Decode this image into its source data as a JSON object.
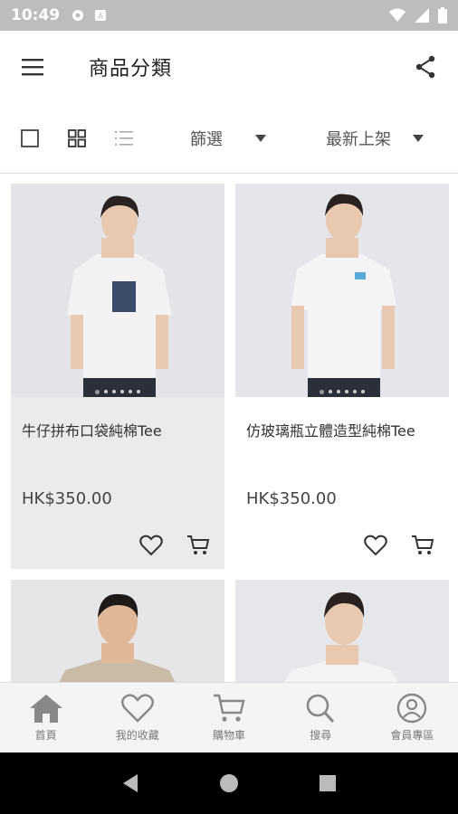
{
  "status_bar": {
    "time": "10:49"
  },
  "app_bar": {
    "title": "商品分類"
  },
  "toolbar": {
    "filter_label": "篩選",
    "sort_label": "最新上架"
  },
  "products": [
    {
      "name": "牛仔拼布口袋純棉Tee",
      "price": "HK$350.00"
    },
    {
      "name": "仿玻璃瓶立體造型純棉Tee",
      "price": "HK$350.00"
    },
    {
      "name": "",
      "price": ""
    },
    {
      "name": "",
      "price": ""
    }
  ],
  "bottom_nav": {
    "items": [
      {
        "label": "首頁",
        "icon": "home-icon"
      },
      {
        "label": "我的收藏",
        "icon": "heart-icon"
      },
      {
        "label": "購物車",
        "icon": "cart-icon"
      },
      {
        "label": "搜尋",
        "icon": "search-icon"
      },
      {
        "label": "會員專區",
        "icon": "user-icon"
      }
    ]
  },
  "colors": {
    "status_bar": "#bdbdbd",
    "card_highlight": "#ebebeb",
    "nav_bg": "#f4f4f4"
  }
}
